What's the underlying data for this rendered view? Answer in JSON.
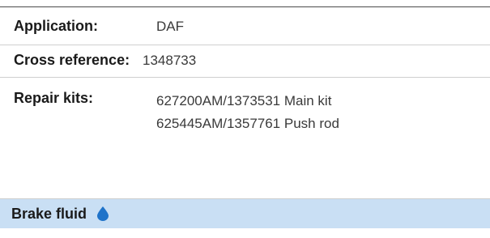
{
  "rows": {
    "application": {
      "label": "Application:",
      "value": "DAF"
    },
    "cross_reference": {
      "label": "Cross reference:",
      "value": "1348733"
    },
    "repair_kits": {
      "label": "Repair kits:",
      "items": [
        "627200AM/1373531 Main kit",
        "625445AM/1357761 Push rod"
      ]
    }
  },
  "footer": {
    "label": "Brake fluid",
    "icon": "water-drop-icon",
    "background": "#c9dff4",
    "icon_color": "#1f73c9"
  }
}
